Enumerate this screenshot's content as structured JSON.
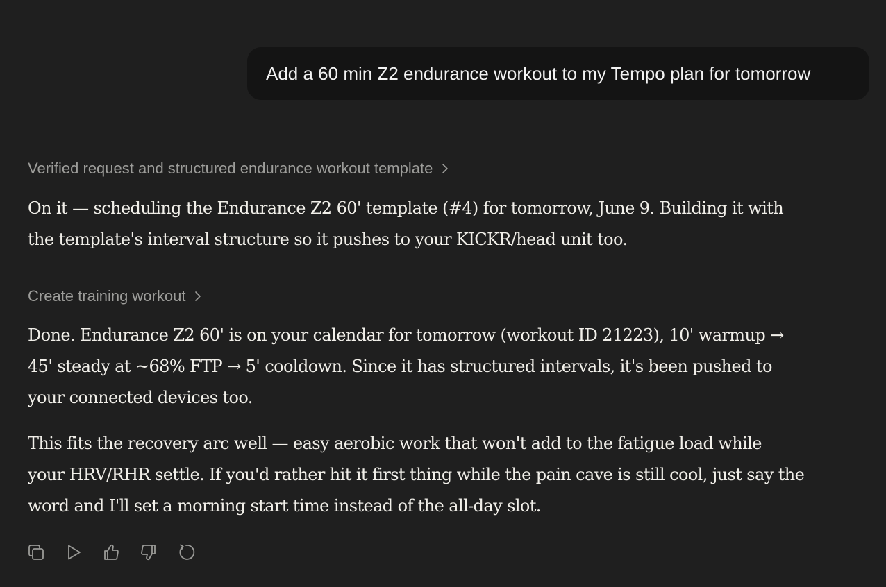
{
  "user_message": {
    "text": "Add a 60 min Z2 endurance workout to my Tempo plan for tomorrow"
  },
  "assistant": {
    "steps": [
      {
        "label": "Verified request and structured endurance workout template",
        "icon": "chevron-right-icon"
      },
      {
        "label": "Create training workout",
        "icon": "chevron-right-icon"
      }
    ],
    "paragraphs": [
      "On it — scheduling the Endurance Z2 60' template (#4) for tomorrow, June 9. Building it with\nthe template's interval structure so it pushes to your KICKR/head unit too.",
      "Done. Endurance Z2 60' is on your calendar for tomorrow (workout ID 21223), 10' warmup →\n45' steady at ~68% FTP → 5' cooldown. Since it has structured intervals, it's been pushed to\nyour connected devices too.",
      "This fits the recovery arc well — easy aerobic work that won't add to the fatigue load while\nyour HRV/RHR settle. If you'd rather hit it first thing while the pain cave is still cool, just say the\nword and I'll set a morning start time instead of the all-day slot."
    ],
    "actions": [
      {
        "name": "copy",
        "icon": "copy-icon"
      },
      {
        "name": "read-aloud",
        "icon": "play-icon"
      },
      {
        "name": "good-response",
        "icon": "thumbs-up-icon"
      },
      {
        "name": "bad-response",
        "icon": "thumbs-down-icon"
      },
      {
        "name": "retry",
        "icon": "retry-icon"
      }
    ]
  },
  "colors": {
    "background": "#1f1f1f",
    "user_bubble": "#141414",
    "body_text": "#f1efe9",
    "muted_text": "#9d9d9a",
    "icon": "#9a9a97"
  }
}
